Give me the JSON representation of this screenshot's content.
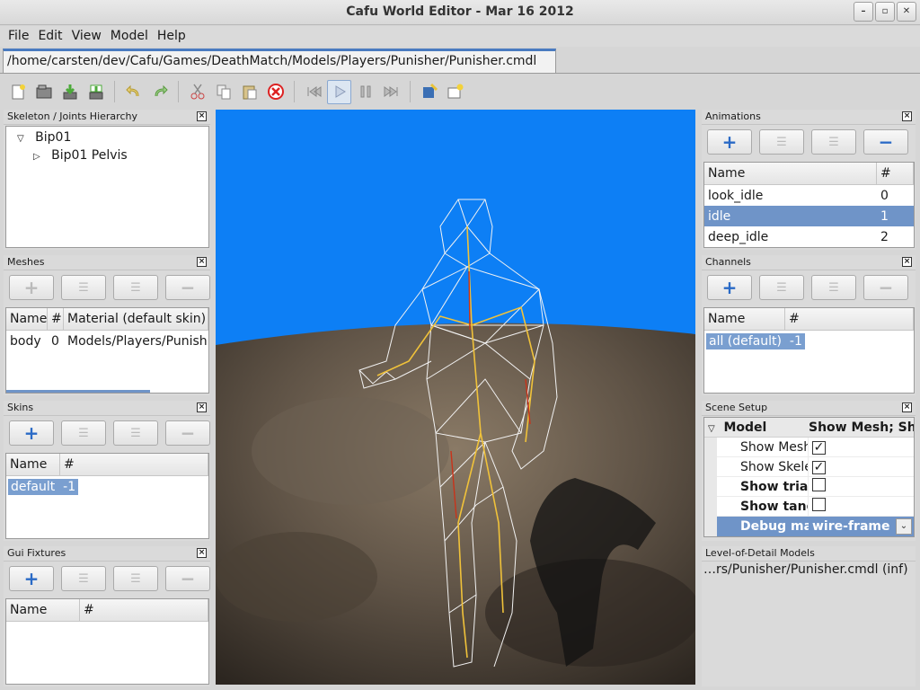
{
  "window": {
    "title": "Cafu World Editor - Mar 16 2012"
  },
  "menu": [
    "File",
    "Edit",
    "View",
    "Model",
    "Help"
  ],
  "file_tab": "/home/carsten/dev/Cafu/Games/DeathMatch/Models/Players/Punisher/Punisher.cmdl",
  "skeleton": {
    "title": "Skeleton / Joints Hierarchy",
    "root": "Bip01",
    "child": "Bip01 Pelvis"
  },
  "meshes": {
    "title": "Meshes",
    "headers": [
      "Name",
      "#",
      "Material (default skin)"
    ],
    "rows": [
      {
        "name": "body",
        "num": "0",
        "material": "Models/Players/Punish"
      }
    ]
  },
  "skins": {
    "title": "Skins",
    "headers": [
      "Name",
      "#"
    ],
    "rows": [
      {
        "name": "default",
        "num": "-1"
      }
    ]
  },
  "gui_fixtures": {
    "title": "Gui Fixtures",
    "headers": [
      "Name",
      "#"
    ]
  },
  "animations": {
    "title": "Animations",
    "headers": [
      "Name",
      "#"
    ],
    "rows": [
      {
        "name": "look_idle",
        "num": "0"
      },
      {
        "name": "idle",
        "num": "1"
      },
      {
        "name": "deep_idle",
        "num": "2"
      }
    ]
  },
  "channels": {
    "title": "Channels",
    "headers": [
      "Name",
      "#"
    ],
    "rows": [
      {
        "name": "all (default)",
        "num": "-1"
      }
    ]
  },
  "scene_setup": {
    "title": "Scene Setup",
    "group": "Model",
    "group_value": "Show Mesh; Sho",
    "props": [
      {
        "label": "Show Mesh",
        "checked": true,
        "bold": false
      },
      {
        "label": "Show Skele",
        "checked": true,
        "bold": false
      },
      {
        "label": "Show trian",
        "checked": false,
        "bold": true
      },
      {
        "label": "Show tang",
        "checked": false,
        "bold": true
      }
    ],
    "debug_label": "Debug mat",
    "debug_value": "wire-frame"
  },
  "lod": {
    "title": "Level-of-Detail Models",
    "item": "…rs/Punisher/Punisher.cmdl (inf)"
  },
  "colors": {
    "accent": "#4a7bc0",
    "selection": "#6f94c8",
    "sky": "#0d7ff5"
  }
}
